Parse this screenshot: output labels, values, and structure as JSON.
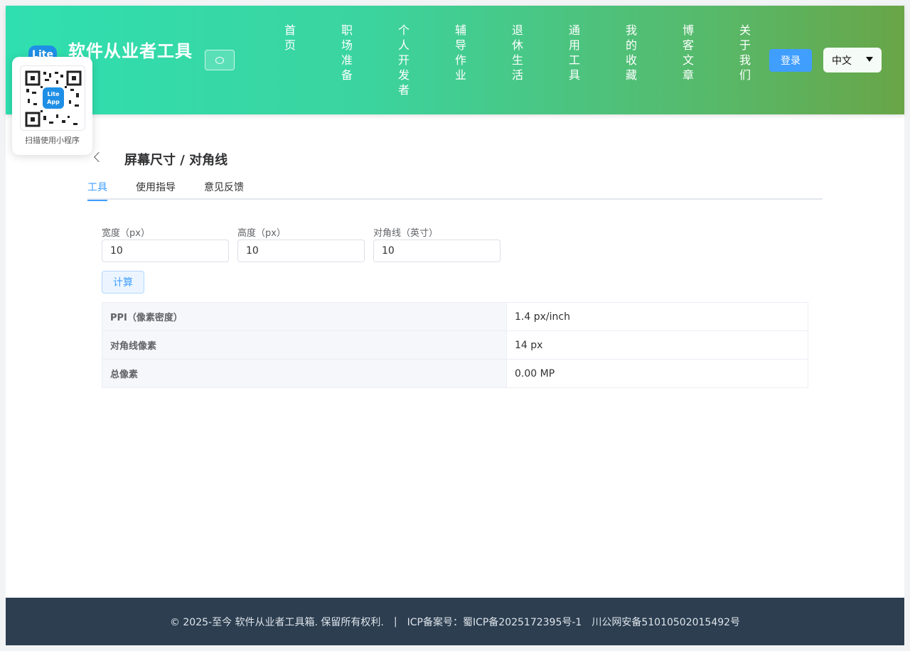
{
  "header": {
    "logo_text": "Lite",
    "brand": "软件从业者工具",
    "nav": [
      "首页",
      "职场准备",
      "个人开发者",
      "辅导作业",
      "退休生活",
      "通用工具",
      "我的收藏",
      "博客文章",
      "关于我们"
    ],
    "login_label": "登录",
    "language": "中文"
  },
  "qr_popup": {
    "center_text_1": "Lite",
    "center_text_2": "App",
    "label": "扫描使用小程序"
  },
  "main": {
    "title": "屏幕尺寸 / 对角线",
    "tabs": [
      "工具",
      "使用指导",
      "意见反馈"
    ],
    "fields": [
      {
        "label": "宽度（px）",
        "value": "10"
      },
      {
        "label": "高度（px）",
        "value": "10"
      },
      {
        "label": "对角线（英寸）",
        "value": "10"
      }
    ],
    "calc_label": "计算",
    "results": [
      {
        "key": "PPI（像素密度）",
        "value": "1.4 px/inch"
      },
      {
        "key": "对角线像素",
        "value": "14 px"
      },
      {
        "key": "总像素",
        "value": "0.00 MP"
      }
    ]
  },
  "footer": {
    "copyright": "© 2025-至今 软件从业者工具箱. 保留所有权利.",
    "separator": "|",
    "icp": "ICP备案号：蜀ICP备2025172395号-1",
    "police": "川公网安备51010502015492号"
  }
}
